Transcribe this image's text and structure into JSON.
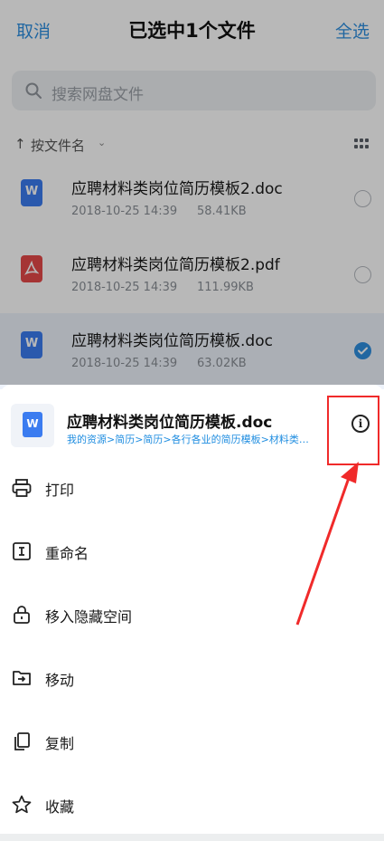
{
  "header": {
    "cancel_label": "取消",
    "title": "已选中1个文件",
    "select_all_label": "全选"
  },
  "search": {
    "placeholder": "搜索网盘文件",
    "icon": "search-icon"
  },
  "sort": {
    "arrow": "↑",
    "label": "按文件名",
    "chevron": "⌄",
    "view_icon": "grid-view-icon"
  },
  "files": [
    {
      "name": "应聘材料类岗位简历模板2.doc",
      "date": "2018-10-25  14:39",
      "size": "58.41KB",
      "type": "word",
      "color": "#3b7cf0",
      "selected": false
    },
    {
      "name": "应聘材料类岗位简历模板2.pdf",
      "date": "2018-10-25  14:39",
      "size": "111.99KB",
      "type": "pdf",
      "color": "#e54848",
      "selected": false
    },
    {
      "name": "应聘材料类岗位简历模板.doc",
      "date": "2018-10-25  14:39",
      "size": "63.02KB",
      "type": "word",
      "color": "#3b7cf0",
      "selected": true
    }
  ],
  "sheet": {
    "file_name": "应聘材料类岗位简历模板.doc",
    "file_path": "我的资源>简历>简历>各行各业的简历模板>材料类简历模板",
    "info_icon": "info-icon",
    "menu": [
      {
        "label": "打印",
        "icon": "printer-icon"
      },
      {
        "label": "重命名",
        "icon": "rename-icon"
      },
      {
        "label": "移入隐藏空间",
        "icon": "lock-icon"
      },
      {
        "label": "移动",
        "icon": "move-folder-icon"
      },
      {
        "label": "复制",
        "icon": "copy-icon"
      },
      {
        "label": "收藏",
        "icon": "star-icon"
      }
    ]
  },
  "colors": {
    "accent": "#2f8fe0",
    "annotation": "#f02a2a"
  }
}
